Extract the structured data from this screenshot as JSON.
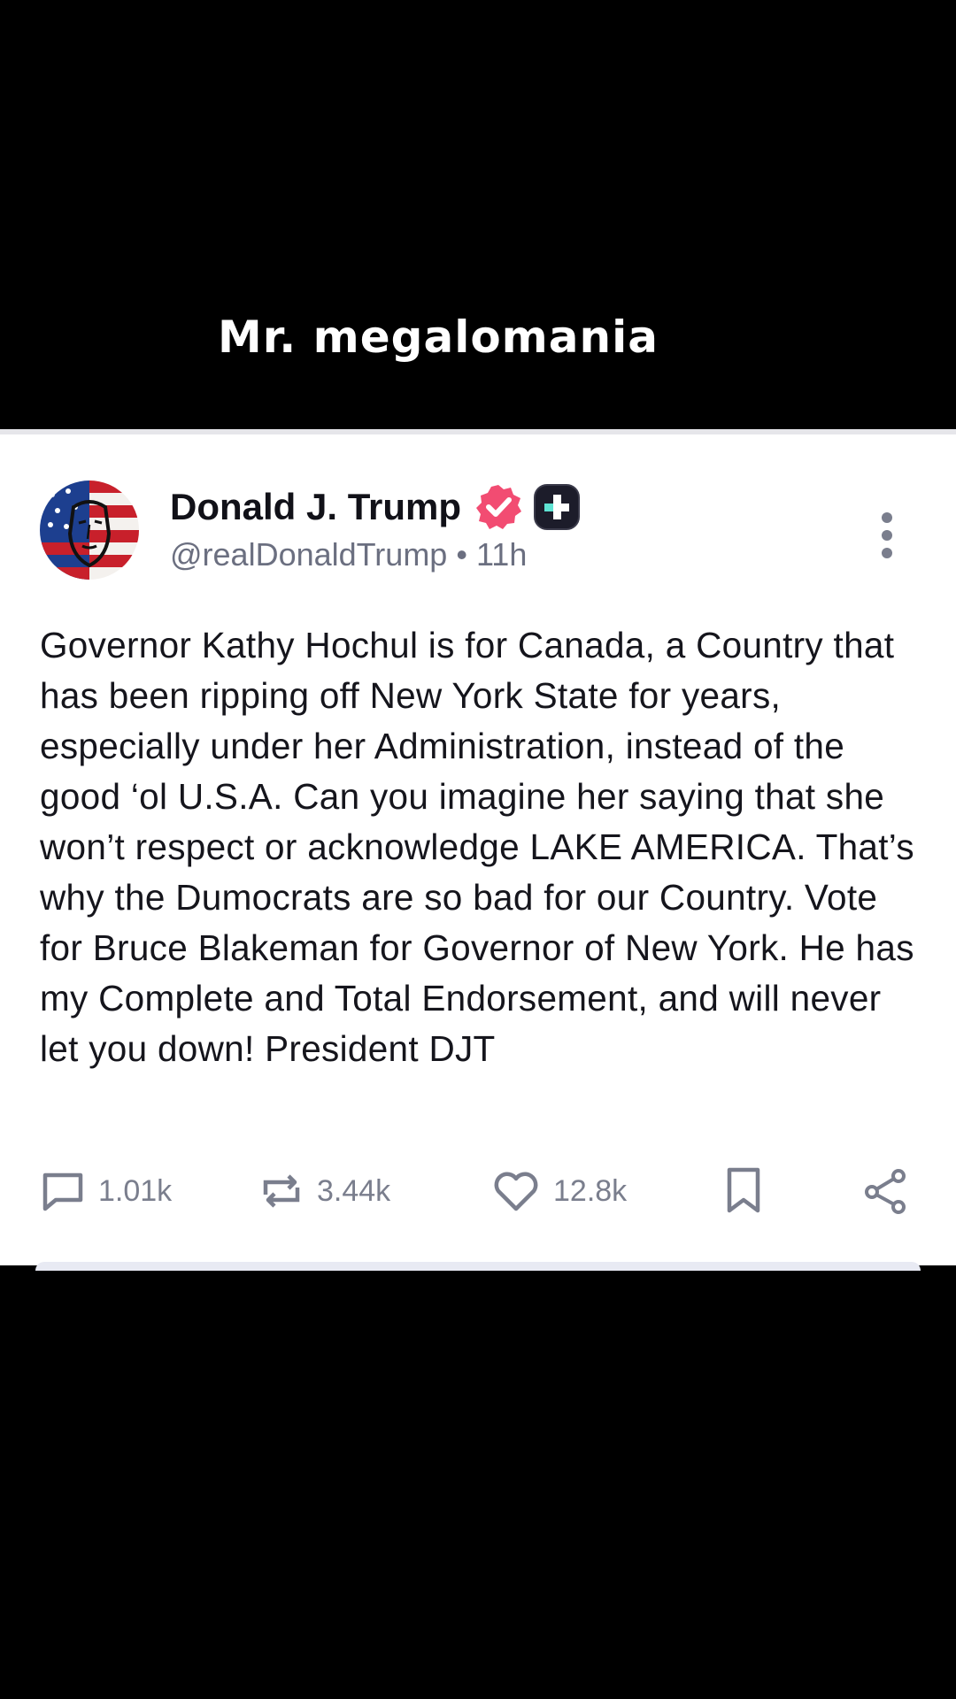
{
  "caption": "Mr. megalomania",
  "post": {
    "author": {
      "name": "Donald J. Trump",
      "handle": "@realDonaldTrump",
      "separator": "•",
      "time": "11h"
    },
    "body": "Governor Kathy Hochul is for Canada, a Country that has been ripping off New York State for years, especially under her Administration, instead of the good ‘ol U.S.A. Can you imagine her saying that she won’t respect or acknowledge LAKE AMERICA. That’s why the Dumocrats are so bad for our Country. Vote for Bruce Blakeman for Governor of New York. He has my Complete and Total Endorsement, and will never let you down! President DJT",
    "actions": {
      "replies": "1.01k",
      "retruths": "3.44k",
      "likes": "12.8k"
    },
    "icons": {
      "verified": "verified-badge-icon",
      "plus": "plus-badge-icon",
      "more": "more-vertical-icon",
      "reply": "reply-icon",
      "retruth": "retruth-icon",
      "like": "heart-icon",
      "bookmark": "bookmark-icon",
      "share": "share-icon"
    }
  },
  "colors": {
    "background": "#000000",
    "card": "#ffffff",
    "verified": "#f24c72",
    "plus_badge": "#1c1c2a",
    "plus_accent": "#5fe3d3",
    "muted_text": "#7a7e8d"
  }
}
